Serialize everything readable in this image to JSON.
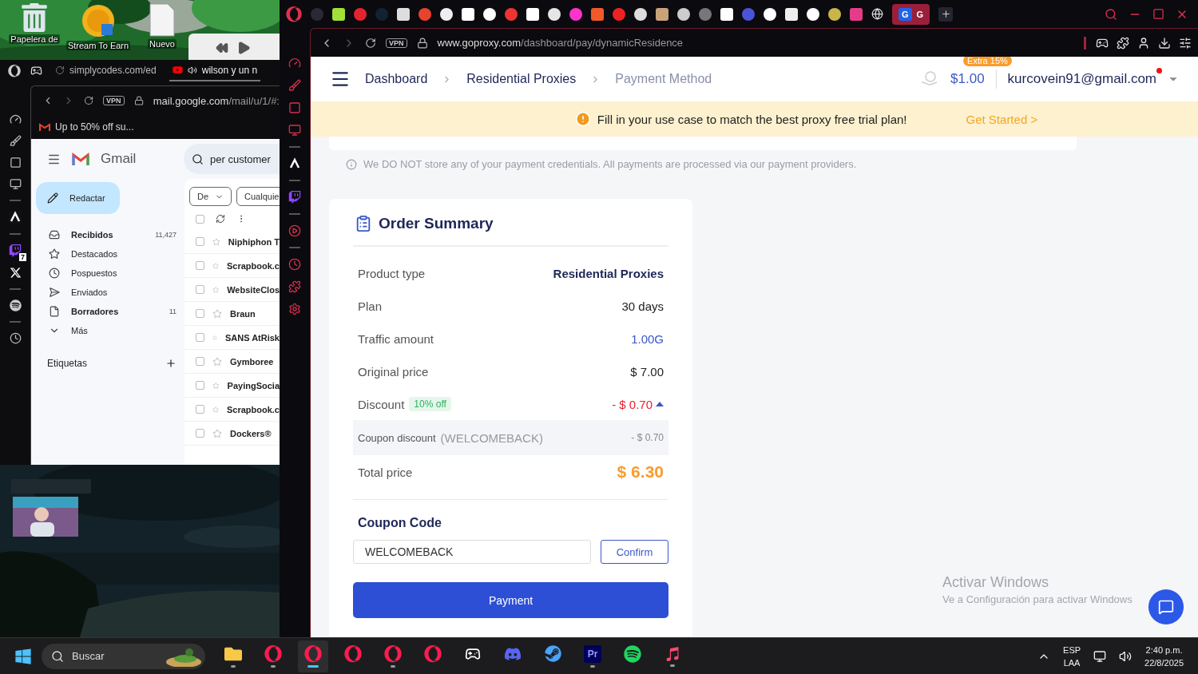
{
  "desktop": {
    "icons": [
      {
        "label": "Papelera de",
        "kind": "bin"
      },
      {
        "label": "Stream To Earn",
        "kind": "coin"
      },
      {
        "label": "Nuevo",
        "kind": "doc"
      }
    ]
  },
  "left_browser": {
    "tabs": [
      {
        "label": "simplycodes.com/ed",
        "kind": "loading",
        "selected": false
      },
      {
        "label": "wilson y un n",
        "kind": "audio",
        "selected": true
      }
    ],
    "vpn": "VPN",
    "address_host": "mail.google.com",
    "address_path": "/mail/u/1/#:",
    "bookmark": "Up to 50% off su...",
    "sidebar_badge": "7"
  },
  "gmail": {
    "title": "Gmail",
    "search": "per customer",
    "compose": "Redactar",
    "nav": [
      {
        "label": "Recibidos",
        "count": "11,427",
        "unread": true,
        "kind": "inbox"
      },
      {
        "label": "Destacados",
        "unread": false,
        "kind": "star"
      },
      {
        "label": "Pospuestos",
        "unread": false,
        "kind": "clock"
      },
      {
        "label": "Enviados",
        "unread": false,
        "kind": "send"
      },
      {
        "label": "Borradores",
        "count": "11",
        "unread": true,
        "kind": "draft"
      },
      {
        "label": "Más",
        "unread": false,
        "kind": "more"
      }
    ],
    "labels_heading": "Etiquetas",
    "filters": [
      "De",
      "Cualquie"
    ],
    "select_all": {
      "checked": false
    },
    "emails": [
      {
        "sender": "Niphiphon T",
        "unread": true
      },
      {
        "sender": "Scrapbook.c",
        "unread": true
      },
      {
        "sender": "WebsiteClos",
        "unread": true
      },
      {
        "sender": "Braun",
        "unread": true
      },
      {
        "sender": "SANS AtRisk",
        "unread": true
      },
      {
        "sender": "Gymboree",
        "unread": true
      },
      {
        "sender": "PayingSocia",
        "unread": true
      },
      {
        "sender": "Scrapbook.c",
        "unread": true
      },
      {
        "sender": "Dockers®",
        "unread": true
      }
    ]
  },
  "browser": {
    "pinned_tab": [
      "G",
      "G"
    ],
    "vpn": "VPN",
    "address_host": "www.goproxy.com",
    "address_path": "/dashboard/pay/dynamicResidence"
  },
  "page": {
    "breadcrumbs": [
      {
        "label": "Dashboard",
        "selected": false
      },
      {
        "label": "Residential Proxies",
        "selected": false
      },
      {
        "label": "Payment Method",
        "selected": true
      }
    ],
    "balance": "$1.00",
    "balance_badge": "Extra 15%",
    "account": "kurcovein91@gmail.com",
    "notification": true,
    "banner": {
      "text": "Fill in your use case to match the best proxy free trial plan!",
      "action": "Get Started >"
    },
    "note": "We DO NOT store any of your payment credentials. All payments are processed via our payment providers.",
    "order_summary": {
      "title": "Order Summary",
      "rows": [
        {
          "kind": "strong",
          "label": "Product type",
          "value": "Residential Proxies"
        },
        {
          "kind": "plain",
          "label": "Plan",
          "value": "30 days"
        },
        {
          "kind": "link",
          "label": "Traffic amount",
          "value": "1.00G"
        },
        {
          "kind": "plain",
          "label": "Original price",
          "value": "$ 7.00"
        },
        {
          "kind": "discount",
          "label": "Discount",
          "badge": "10% off",
          "value": "- $ 0.70",
          "expanded": true
        },
        {
          "kind": "coupon",
          "label": "Coupon discount",
          "code": "(WELCOMEBACK)",
          "value": "- $ 0.70"
        },
        {
          "kind": "total",
          "label": "Total price",
          "value": "$ 6.30"
        }
      ],
      "coupon_heading": "Coupon Code",
      "coupon_value": "WELCOMEBACK",
      "confirm": "Confirm",
      "payment": "Payment"
    }
  },
  "windows_notice": {
    "title": "Activar Windows",
    "subtitle": "Ve a Configuración para activar Windows"
  },
  "taskbar": {
    "search": "Buscar",
    "apps": [
      {
        "kind": "explorer",
        "running": true,
        "active": false
      },
      {
        "kind": "opera",
        "running": true,
        "active": false
      },
      {
        "kind": "opera",
        "running": true,
        "active": true
      },
      {
        "kind": "opera",
        "running": false,
        "active": false
      },
      {
        "kind": "opera",
        "running": true,
        "active": false
      },
      {
        "kind": "opera",
        "running": false,
        "active": false
      },
      {
        "kind": "epic",
        "running": false,
        "active": false
      },
      {
        "kind": "discord",
        "running": false,
        "active": false
      },
      {
        "kind": "steam",
        "running": false,
        "active": false
      },
      {
        "kind": "premiere",
        "label": "Pr",
        "running": true,
        "active": false
      },
      {
        "kind": "spotify",
        "running": false,
        "active": false
      },
      {
        "kind": "music",
        "running": true,
        "active": false
      }
    ],
    "language": [
      "ESP",
      "LAA"
    ],
    "time": "2:40 p.m.",
    "date": "22/8/2025"
  }
}
